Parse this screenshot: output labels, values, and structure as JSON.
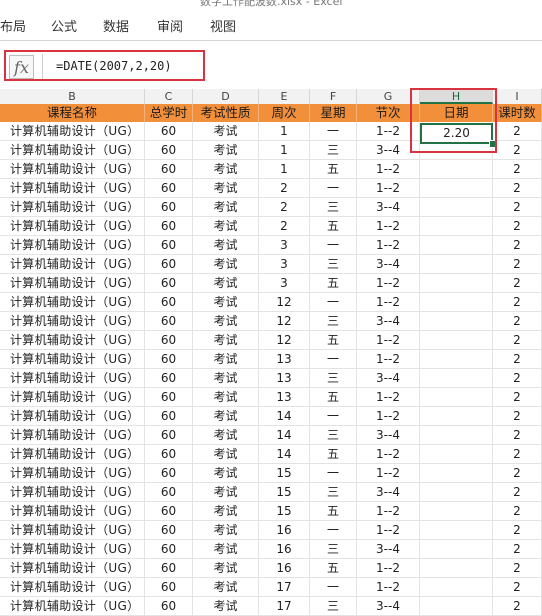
{
  "window": {
    "title": "数字工作配波数.xlsx - Excel"
  },
  "ribbon": {
    "tabs": [
      "布局",
      "公式",
      "数据",
      "审阅",
      "视图"
    ]
  },
  "formula_bar": {
    "fx_label": "fx",
    "formula": "=DATE(2007,2,20)"
  },
  "column_letters": [
    "B",
    "C",
    "D",
    "E",
    "F",
    "G",
    "H",
    "I"
  ],
  "active_column": "H",
  "headers": [
    "课程名称",
    "总学时",
    "考试性质",
    "周次",
    "星期",
    "节次",
    "日期",
    "课时数"
  ],
  "selected_cell_value": "2.20",
  "rows": [
    [
      "计算机辅助设计（UG）",
      "60",
      "考试",
      "1",
      "一",
      "1--2",
      "",
      "2"
    ],
    [
      "计算机辅助设计（UG）",
      "60",
      "考试",
      "1",
      "三",
      "3--4",
      "",
      "2"
    ],
    [
      "计算机辅助设计（UG）",
      "60",
      "考试",
      "1",
      "五",
      "1--2",
      "",
      "2"
    ],
    [
      "计算机辅助设计（UG）",
      "60",
      "考试",
      "2",
      "一",
      "1--2",
      "",
      "2"
    ],
    [
      "计算机辅助设计（UG）",
      "60",
      "考试",
      "2",
      "三",
      "3--4",
      "",
      "2"
    ],
    [
      "计算机辅助设计（UG）",
      "60",
      "考试",
      "2",
      "五",
      "1--2",
      "",
      "2"
    ],
    [
      "计算机辅助设计（UG）",
      "60",
      "考试",
      "3",
      "一",
      "1--2",
      "",
      "2"
    ],
    [
      "计算机辅助设计（UG）",
      "60",
      "考试",
      "3",
      "三",
      "3--4",
      "",
      "2"
    ],
    [
      "计算机辅助设计（UG）",
      "60",
      "考试",
      "3",
      "五",
      "1--2",
      "",
      "2"
    ],
    [
      "计算机辅助设计（UG）",
      "60",
      "考试",
      "12",
      "一",
      "1--2",
      "",
      "2"
    ],
    [
      "计算机辅助设计（UG）",
      "60",
      "考试",
      "12",
      "三",
      "3--4",
      "",
      "2"
    ],
    [
      "计算机辅助设计（UG）",
      "60",
      "考试",
      "12",
      "五",
      "1--2",
      "",
      "2"
    ],
    [
      "计算机辅助设计（UG）",
      "60",
      "考试",
      "13",
      "一",
      "1--2",
      "",
      "2"
    ],
    [
      "计算机辅助设计（UG）",
      "60",
      "考试",
      "13",
      "三",
      "3--4",
      "",
      "2"
    ],
    [
      "计算机辅助设计（UG）",
      "60",
      "考试",
      "13",
      "五",
      "1--2",
      "",
      "2"
    ],
    [
      "计算机辅助设计（UG）",
      "60",
      "考试",
      "14",
      "一",
      "1--2",
      "",
      "2"
    ],
    [
      "计算机辅助设计（UG）",
      "60",
      "考试",
      "14",
      "三",
      "3--4",
      "",
      "2"
    ],
    [
      "计算机辅助设计（UG）",
      "60",
      "考试",
      "14",
      "五",
      "1--2",
      "",
      "2"
    ],
    [
      "计算机辅助设计（UG）",
      "60",
      "考试",
      "15",
      "一",
      "1--2",
      "",
      "2"
    ],
    [
      "计算机辅助设计（UG）",
      "60",
      "考试",
      "15",
      "三",
      "3--4",
      "",
      "2"
    ],
    [
      "计算机辅助设计（UG）",
      "60",
      "考试",
      "15",
      "五",
      "1--2",
      "",
      "2"
    ],
    [
      "计算机辅助设计（UG）",
      "60",
      "考试",
      "16",
      "一",
      "1--2",
      "",
      "2"
    ],
    [
      "计算机辅助设计（UG）",
      "60",
      "考试",
      "16",
      "三",
      "3--4",
      "",
      "2"
    ],
    [
      "计算机辅助设计（UG）",
      "60",
      "考试",
      "16",
      "五",
      "1--2",
      "",
      "2"
    ],
    [
      "计算机辅助设计（UG）",
      "60",
      "考试",
      "17",
      "一",
      "1--2",
      "",
      "2"
    ],
    [
      "计算机辅助设计（UG）",
      "60",
      "考试",
      "17",
      "三",
      "3--4",
      "",
      "2"
    ]
  ],
  "colors": {
    "header_fill": "#f28f3b",
    "selection_border": "#217346",
    "annotation_border": "#d9333f"
  }
}
